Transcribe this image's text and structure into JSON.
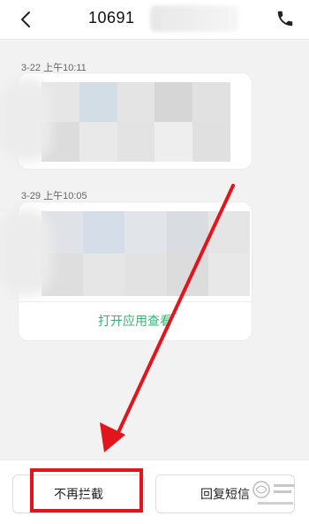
{
  "header": {
    "back_icon": "chevron-left-icon",
    "title_visible": "10691",
    "call_icon": "phone-icon"
  },
  "messages": [
    {
      "timestamp": "3-22 上午10:11"
    },
    {
      "timestamp": "3-29 上午10:05",
      "action_label": "打开应用查看"
    }
  ],
  "bottom_bar": {
    "unblock_label": "不再拦截",
    "reply_label": "回复短信"
  },
  "colors": {
    "accent_green": "#3cb371",
    "annotation_red": "#e2141c",
    "background": "#f2f2f2"
  }
}
